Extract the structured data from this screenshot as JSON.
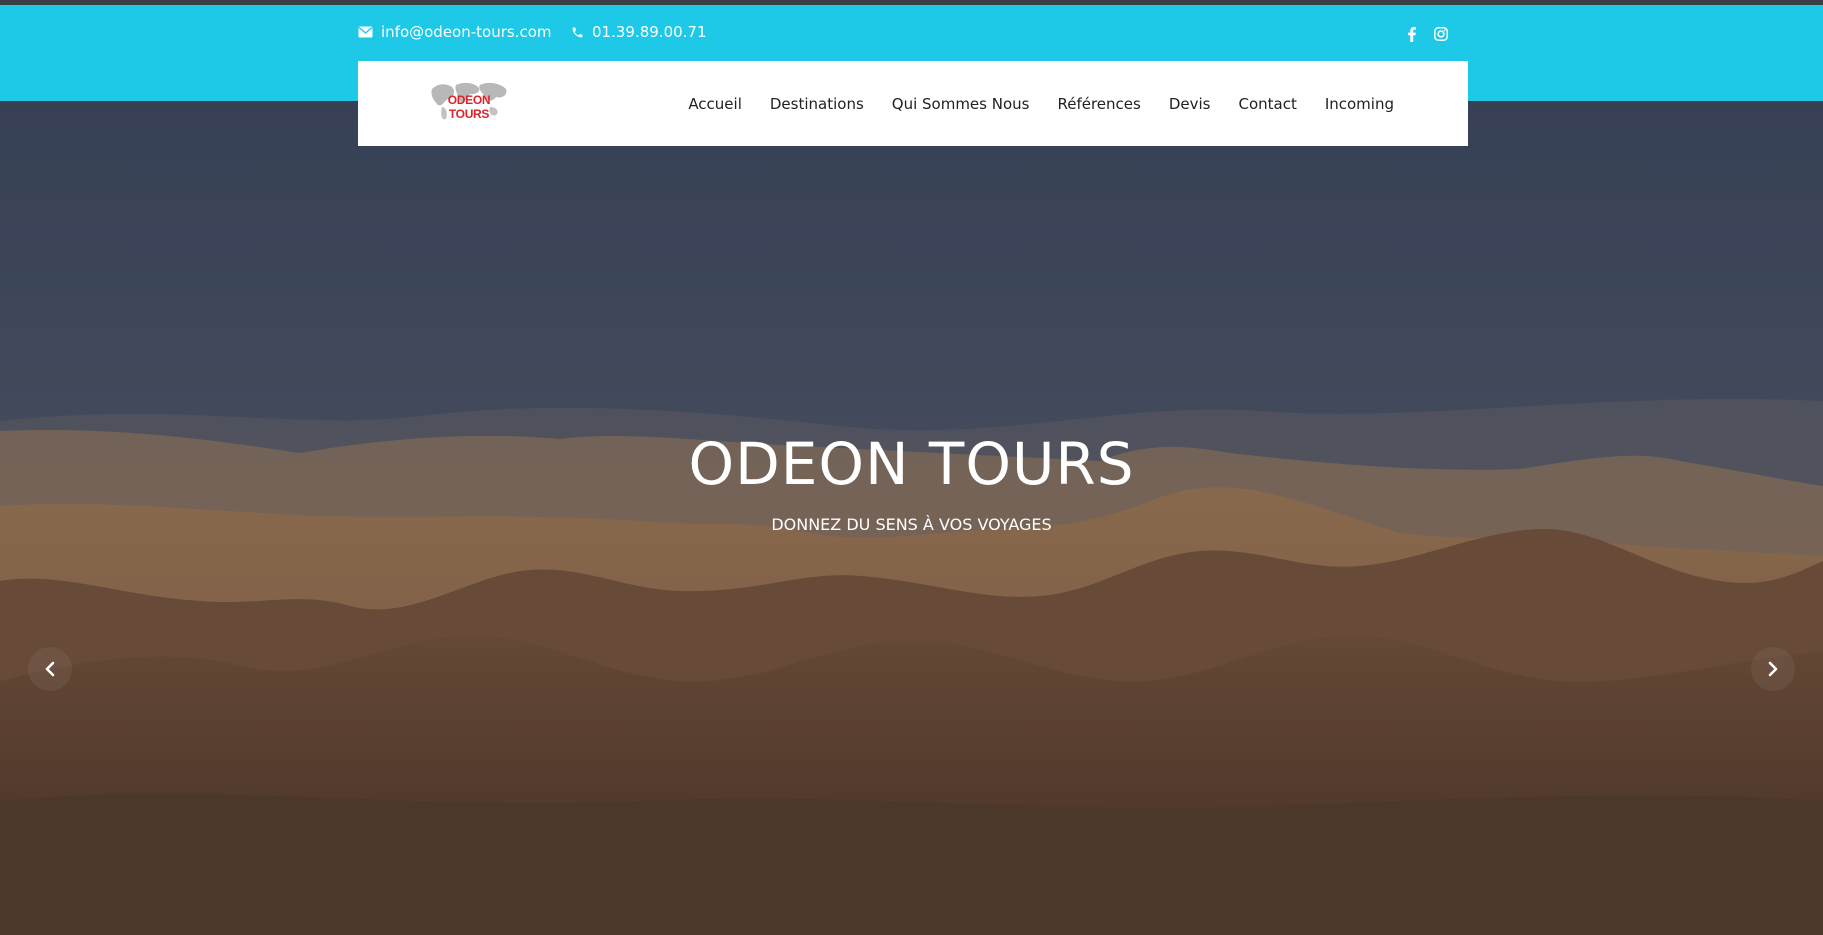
{
  "topbar": {
    "email": "info@odeon-tours.com",
    "phone": "01.39.89.00.71",
    "social": [
      "facebook-icon",
      "instagram-icon"
    ],
    "color": "#1ec9e8"
  },
  "logo": {
    "text": "ODEON TOURS"
  },
  "nav": {
    "items": [
      {
        "label": "Accueil"
      },
      {
        "label": "Destinations"
      },
      {
        "label": "Qui Sommes Nous"
      },
      {
        "label": "Références"
      },
      {
        "label": "Devis"
      },
      {
        "label": "Contact"
      },
      {
        "label": "Incoming"
      }
    ]
  },
  "hero": {
    "title": "ODEON TOURS",
    "subtitle": "DONNEZ DU SENS À VOS VOYAGES",
    "prev_icon": "chevron-left-icon",
    "next_icon": "chevron-right-icon"
  }
}
